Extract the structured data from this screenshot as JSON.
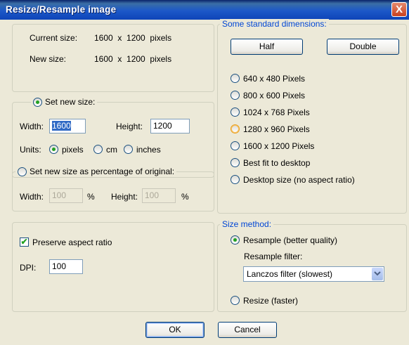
{
  "window": {
    "title": "Resize/Resample image",
    "close_label": "X"
  },
  "info": {
    "current_label": "Current size:",
    "current_value": "1600  x  1200  pixels",
    "new_label": "New size:",
    "new_value": "1600  x  1200  pixels"
  },
  "set_new_size": {
    "radio_label": "Set new size:",
    "width_label": "Width:",
    "width_value": "1600",
    "height_label": "Height:",
    "height_value": "1200",
    "units_label": "Units:",
    "units": [
      "pixels",
      "cm",
      "inches"
    ],
    "units_selected": "pixels"
  },
  "percentage": {
    "radio_label": "Set new size as percentage of original:",
    "width_label": "Width:",
    "width_value": "100",
    "width_unit": "%",
    "height_label": "Height:",
    "height_value": "100",
    "height_unit": "%"
  },
  "options": {
    "preserve_label": "Preserve aspect ratio",
    "preserve_checked": true,
    "dpi_label": "DPI:",
    "dpi_value": "100"
  },
  "standard": {
    "legend": "Some standard dimensions:",
    "half_label": "Half",
    "double_label": "Double",
    "options": [
      "640 x 480 Pixels",
      "800 x 600 Pixels",
      "1024 x 768 Pixels",
      "1280 x 960 Pixels",
      "1600 x 1200 Pixels",
      "Best fit to desktop",
      "Desktop size (no aspect ratio)"
    ]
  },
  "method": {
    "legend": "Size method:",
    "resample_label": "Resample (better quality)",
    "filter_label": "Resample filter:",
    "filter_value": "Lanczos filter (slowest)",
    "resize_label": "Resize (faster)",
    "selected": "resample"
  },
  "footer": {
    "ok_label": "OK",
    "cancel_label": "Cancel"
  },
  "colors": {
    "accent_blue": "#0046d5",
    "radio_dot": "#21a121",
    "title_bar": "#1c58c8",
    "close_button": "#c9401f"
  }
}
